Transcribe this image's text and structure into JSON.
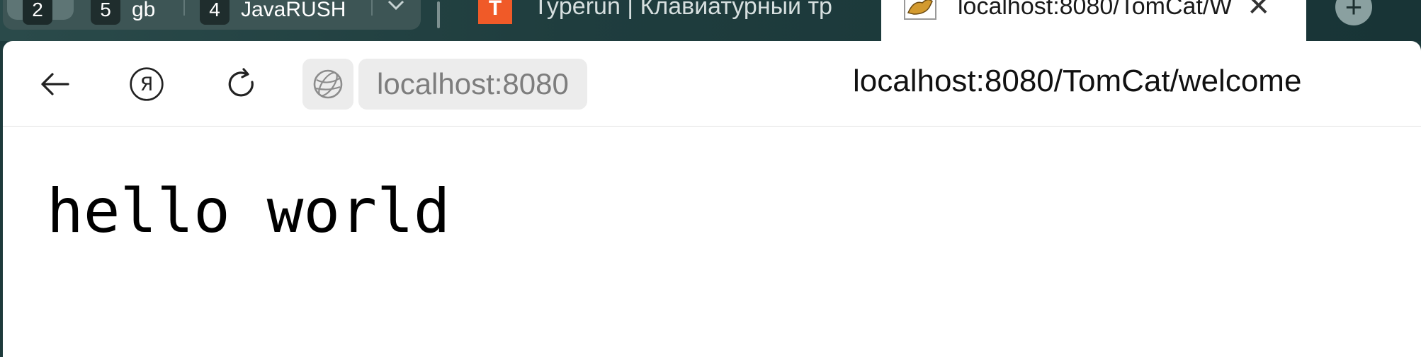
{
  "tab_strip": {
    "groups": [
      {
        "badge": "2",
        "label": ""
      },
      {
        "badge": "5",
        "label": "gb"
      },
      {
        "badge": "4",
        "label": "JavaRUSH"
      }
    ],
    "tabs": [
      {
        "title": "Typerun | Клавиатурный тр",
        "favicon": "typerun-favicon-icon"
      },
      {
        "title": "localhost:8080/TomCat/W",
        "favicon": "tomcat-favicon-icon",
        "active": true
      }
    ]
  },
  "toolbar": {
    "host_chip": "localhost:8080",
    "address": "localhost:8080/TomCat/welcome"
  },
  "page": {
    "heading": "hello world"
  },
  "colors": {
    "tabstrip_bg": "#1d3a3b",
    "typerun_accent": "#f05a28",
    "chip_bg": "#ececec"
  }
}
